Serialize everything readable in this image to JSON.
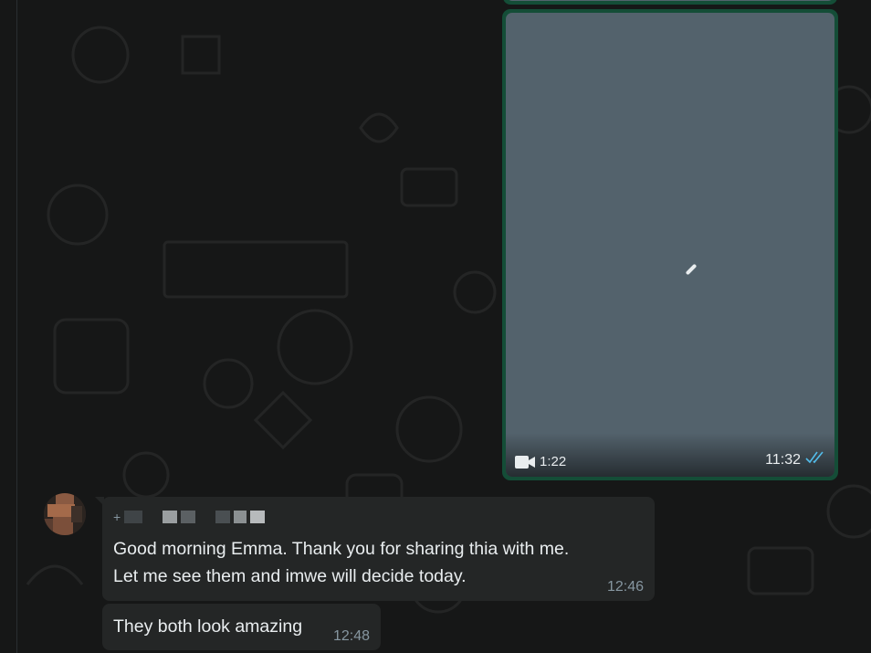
{
  "colors": {
    "chat_background": "#161717",
    "outgoing_bubble": "#144d37",
    "incoming_bubble": "#242626",
    "video_placeholder": "#53626c",
    "read_ticks": "#53bdeb",
    "meta_text": "#8696a0",
    "primary_text": "#e9edef"
  },
  "outgoing_video": {
    "duration": "1:22",
    "duration_icon": "video-camera-icon",
    "time": "11:32",
    "status_icon": "double-check-read-icon"
  },
  "incoming_message_1": {
    "sender_prefix": "+",
    "lines": [
      "Good morning Emma. Thank you for sharing thia with me.",
      "Let me see them and imwe will decide today."
    ],
    "time": "12:46"
  },
  "incoming_message_2": {
    "text": "They both look amazing",
    "time": "12:48"
  }
}
